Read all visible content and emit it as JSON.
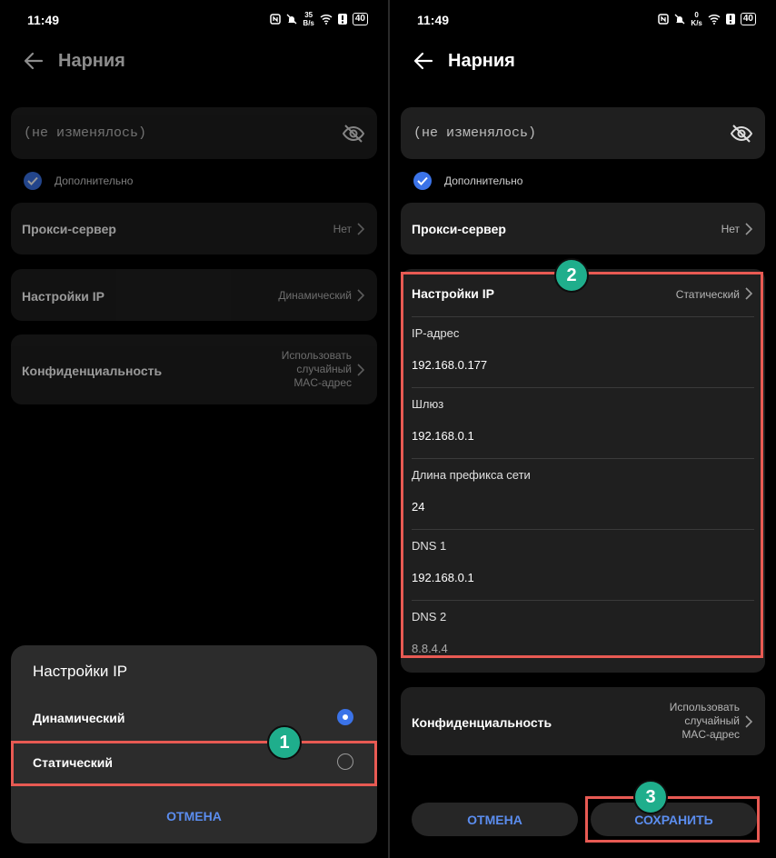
{
  "left": {
    "status": {
      "time": "11:49",
      "speed_top": "35",
      "speed_unit": "B/s",
      "battery": "40"
    },
    "header": {
      "title": "Нарния"
    },
    "password": {
      "value": "(не изменялось)"
    },
    "advanced": {
      "label": "Дополнительно",
      "checked": true
    },
    "proxy": {
      "label": "Прокси-сервер",
      "value": "Нет"
    },
    "ip_settings": {
      "label": "Настройки IP",
      "value": "Динамический"
    },
    "privacy": {
      "label": "Конфиденциальность",
      "value_lines": [
        "Использовать",
        "случайный",
        "MAC-адрес"
      ]
    },
    "dialog": {
      "title": "Настройки IP",
      "options": [
        {
          "label": "Динамический",
          "selected": true
        },
        {
          "label": "Статический",
          "selected": false
        }
      ],
      "cancel": "ОТМЕНА"
    },
    "badge": "1"
  },
  "right": {
    "status": {
      "time": "11:49",
      "speed_top": "0",
      "speed_unit": "K/s",
      "battery": "40"
    },
    "header": {
      "title": "Нарния"
    },
    "password": {
      "value": "(не изменялось)"
    },
    "advanced": {
      "label": "Дополнительно",
      "checked": true
    },
    "proxy": {
      "label": "Прокси-сервер",
      "value": "Нет"
    },
    "ip_settings": {
      "label": "Настройки IP",
      "value": "Статический"
    },
    "fields": [
      {
        "label": "IP-адрес",
        "value": "192.168.0.177"
      },
      {
        "label": "Шлюз",
        "value": "192.168.0.1"
      },
      {
        "label": "Длина префикса сети",
        "value": "24"
      },
      {
        "label": "DNS 1",
        "value": "192.168.0.1"
      },
      {
        "label": "DNS 2",
        "value": "8.8.4.4"
      }
    ],
    "privacy": {
      "label": "Конфиденциальность",
      "value_lines": [
        "Использовать",
        "случайный",
        "MAC-адрес"
      ]
    },
    "buttons": {
      "cancel": "ОТМЕНА",
      "save": "СОХРАНИТЬ"
    },
    "badges": [
      "2",
      "3"
    ]
  },
  "colors": {
    "accent": "#3b73e8",
    "highlight": "#e85a53",
    "badge": "#1fae8c",
    "card": "#1f1f1f"
  }
}
